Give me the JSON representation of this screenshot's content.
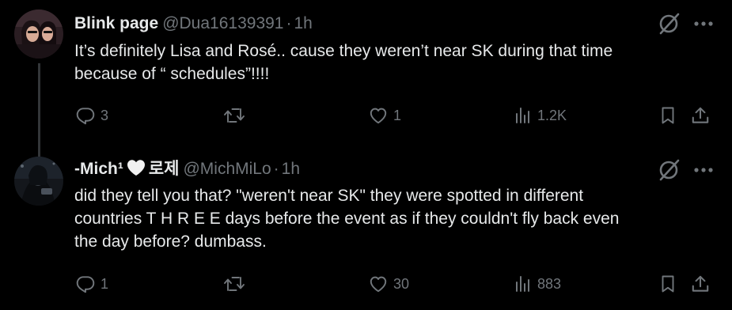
{
  "tweets": [
    {
      "display_name": "Blink page",
      "handle": "@Dua16139391",
      "separator": "·",
      "time": "1h",
      "text_lines": [
        "It’s definitely Lisa and Rosé.. cause they weren’t near SK during that time",
        "because of  “ schedules”!!!!"
      ],
      "replies": "3",
      "retweets": "",
      "likes": "1",
      "views": "1.2K"
    },
    {
      "display_name": "-Mich¹",
      "name_suffix": "로제",
      "handle": "@MichMiLo",
      "separator": "·",
      "time": "1h",
      "text_lines": [
        "did they tell you that? \"weren't near SK\" they were spotted in different",
        "countries T H R E E days before the event as if they couldn't fly back even",
        "the day before? dumbass."
      ],
      "replies": "1",
      "retweets": "",
      "likes": "30",
      "views": "883"
    }
  ],
  "colors": {
    "background": "#000000",
    "text_primary": "#e7e9ea",
    "text_secondary": "#71767b",
    "thread_line": "#333639"
  },
  "icons": {
    "reply": "reply-icon",
    "retweet": "retweet-icon",
    "like": "heart-icon",
    "views": "views-icon",
    "bookmark": "bookmark-icon",
    "share": "share-icon",
    "grok": "grok-icon",
    "more": "more-icon"
  }
}
